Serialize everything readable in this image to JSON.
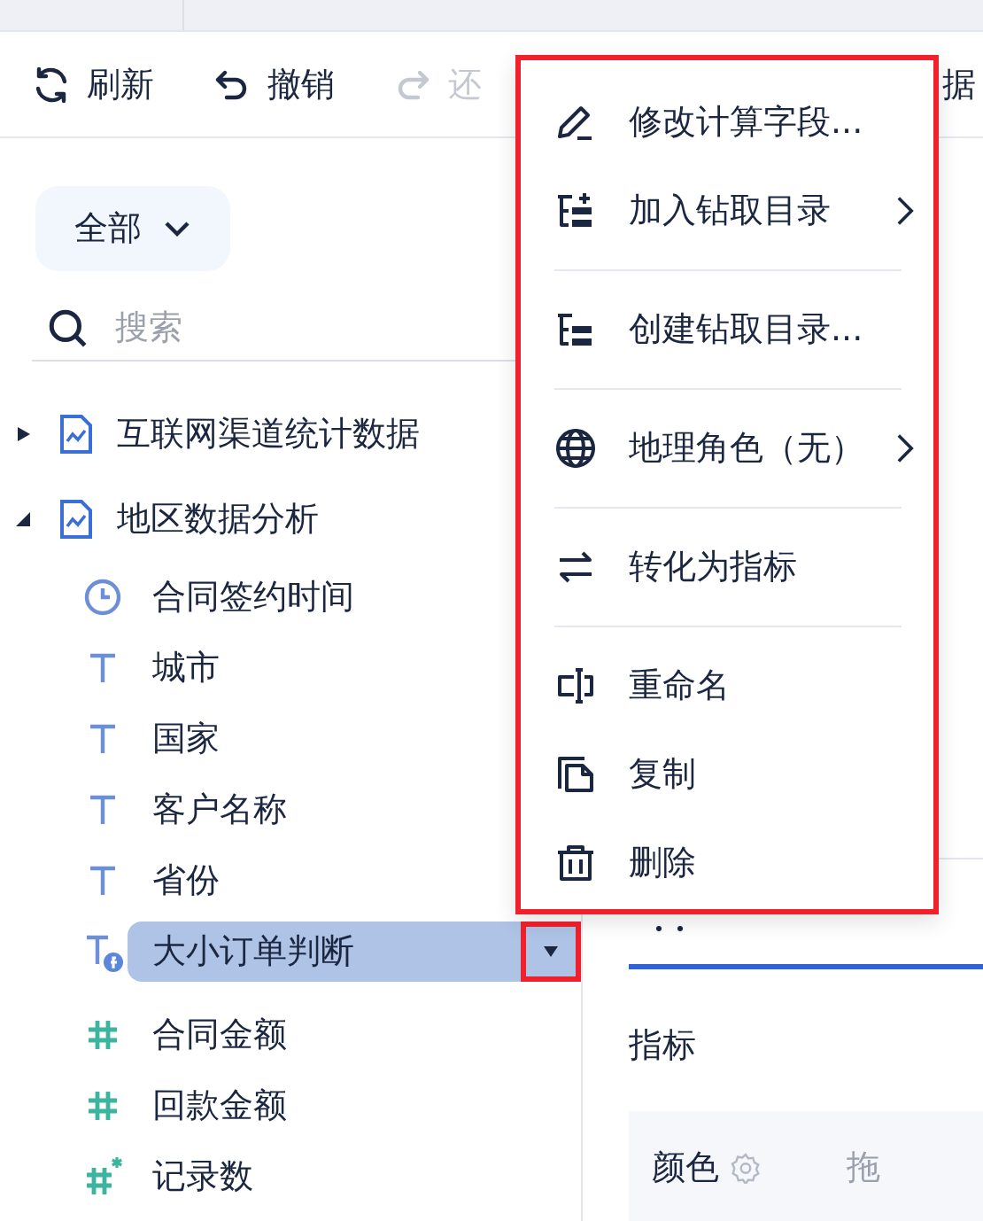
{
  "toolbar": [
    {
      "label": "刷新",
      "kind": "refresh",
      "disabled": false
    },
    {
      "label": "撤销",
      "kind": "undo",
      "disabled": false
    },
    {
      "label": "还",
      "kind": "redo",
      "disabled": true
    }
  ],
  "toolbar_overflow": "据",
  "filter": {
    "label": "全部"
  },
  "search": {
    "placeholder": "搜索"
  },
  "tree": [
    {
      "label": "互联网渠道统计数据",
      "expanded": false
    },
    {
      "label": "地区数据分析",
      "expanded": true,
      "children": [
        {
          "label": "合同签约时间",
          "kind": "date",
          "selected": false
        },
        {
          "label": "城市",
          "kind": "text",
          "selected": false
        },
        {
          "label": "国家",
          "kind": "text",
          "selected": false
        },
        {
          "label": "客户名称",
          "kind": "text",
          "selected": false
        },
        {
          "label": "省份",
          "kind": "text",
          "selected": false
        },
        {
          "label": "大小订单判断",
          "kind": "calc_text",
          "selected": true
        },
        {
          "label": "合同金额",
          "kind": "number",
          "selected": false
        },
        {
          "label": "回款金额",
          "kind": "number",
          "selected": false
        },
        {
          "label": "记录数",
          "kind": "count",
          "selected": false
        }
      ]
    }
  ],
  "context_menu": {
    "highlighted": true,
    "groups": [
      [
        {
          "label": "修改计算字段...",
          "kind": "edit",
          "submenu": false
        },
        {
          "label": "加入钻取目录",
          "kind": "tree_add",
          "submenu": true
        }
      ],
      [
        {
          "label": "创建钻取目录...",
          "kind": "tree",
          "submenu": false
        }
      ],
      [
        {
          "label": "地理角色（无）",
          "kind": "globe",
          "submenu": true
        }
      ],
      [
        {
          "label": "转化为指标",
          "kind": "swap",
          "submenu": false
        }
      ],
      [
        {
          "label": "重命名",
          "kind": "rename",
          "submenu": false
        },
        {
          "label": "复制",
          "kind": "copy",
          "submenu": false
        },
        {
          "label": "删除",
          "kind": "trash",
          "submenu": false
        }
      ]
    ]
  },
  "properties": {
    "tabs": [
      {
        "selected": true
      }
    ],
    "section": "指标",
    "rows": [
      {
        "label": "颜色",
        "placeholder": "拖"
      }
    ]
  }
}
